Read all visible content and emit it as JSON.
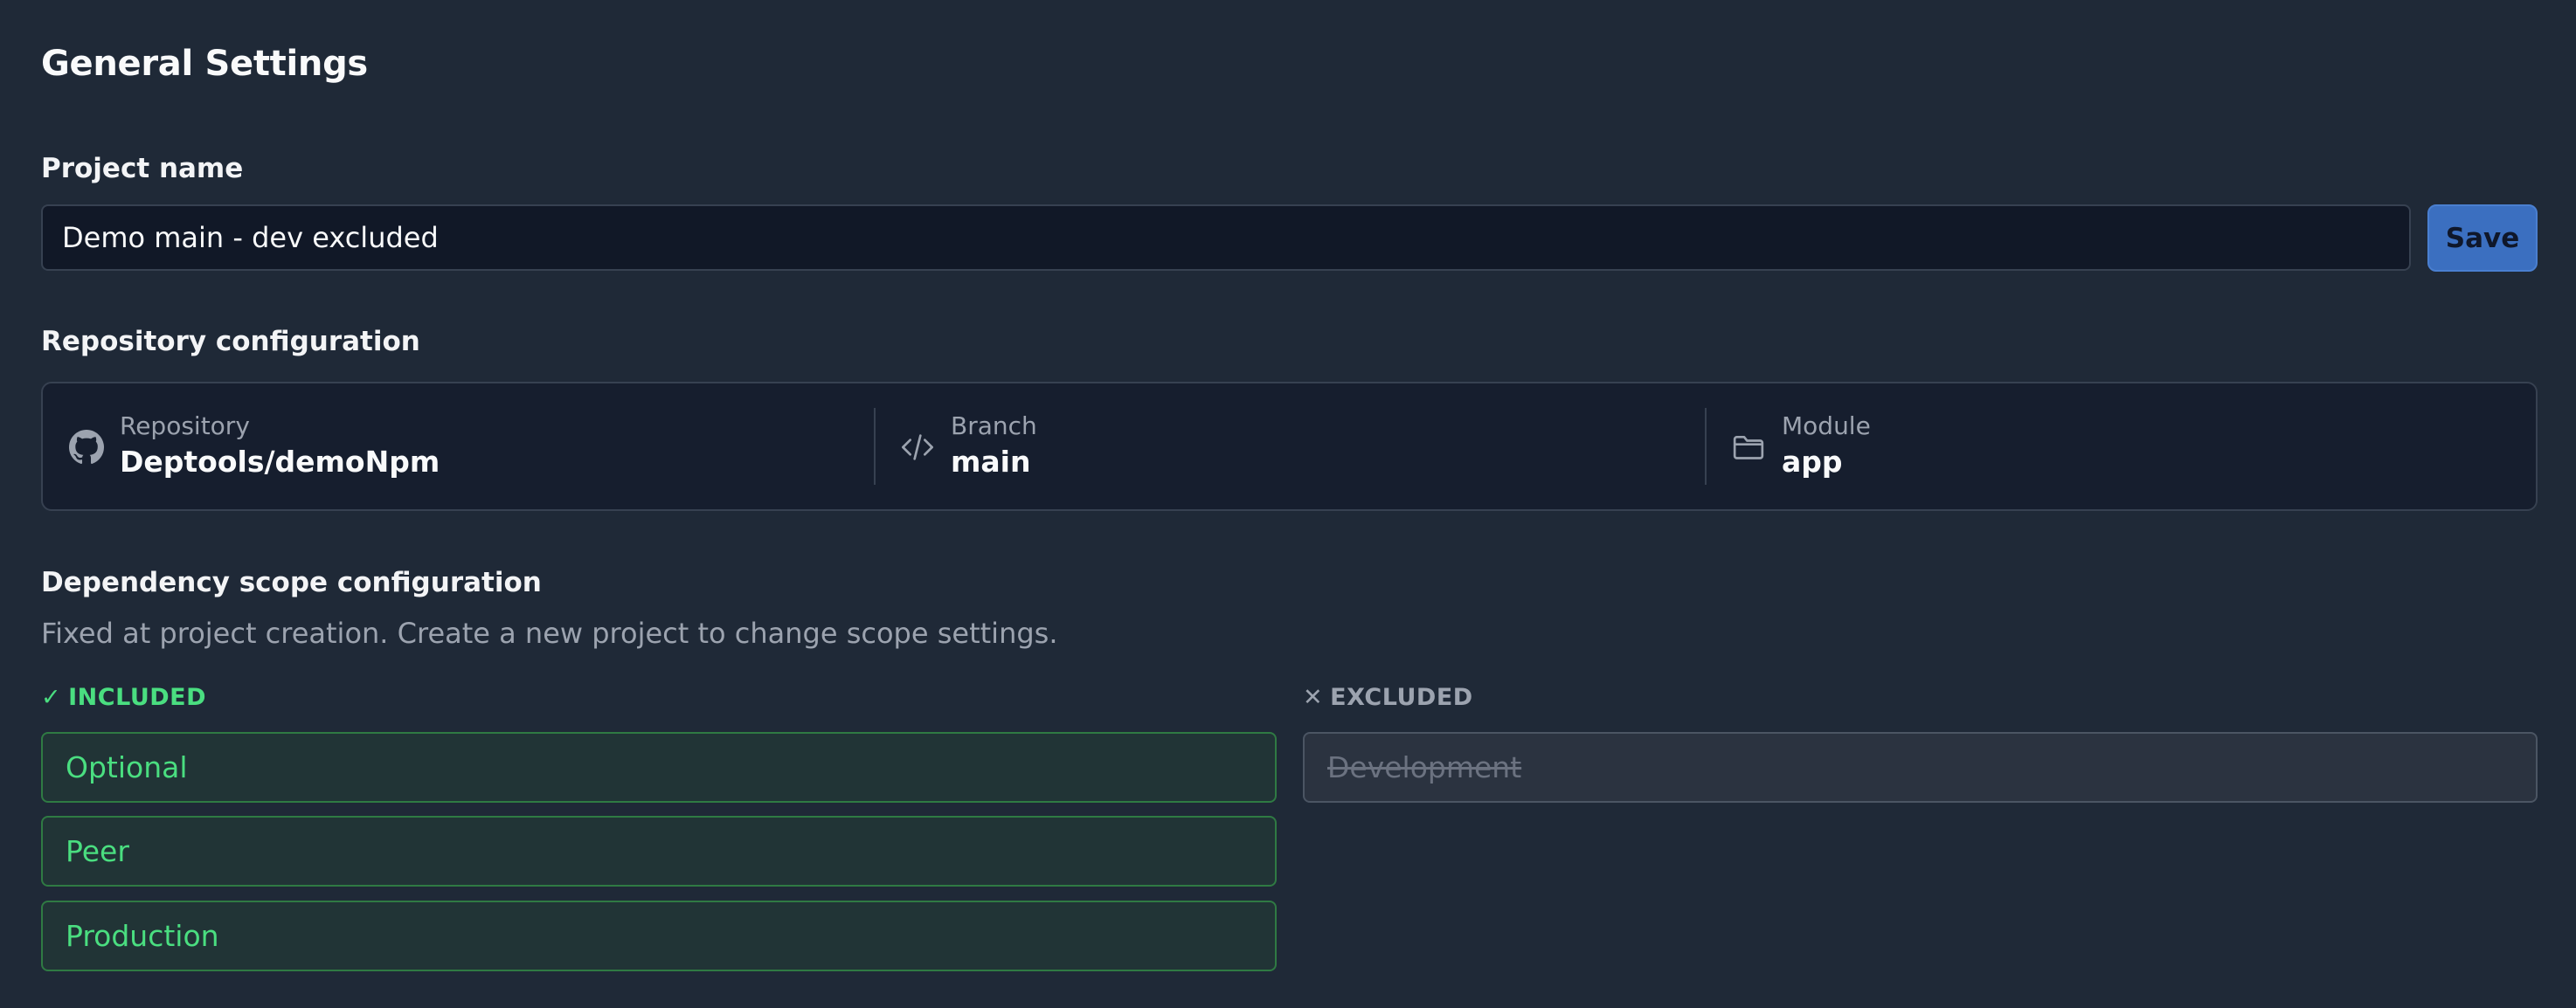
{
  "page": {
    "title": "General Settings"
  },
  "project": {
    "label": "Project name",
    "value": "Demo main - dev excluded",
    "save_label": "Save"
  },
  "repository": {
    "label": "Repository configuration",
    "items": [
      {
        "key": "Repository",
        "value": "Deptools/demoNpm",
        "icon": "github-icon"
      },
      {
        "key": "Branch",
        "value": "main",
        "icon": "code-icon"
      },
      {
        "key": "Module",
        "value": "app",
        "icon": "folder-icon"
      }
    ]
  },
  "scope": {
    "label": "Dependency scope configuration",
    "description": "Fixed at project creation. Create a new project to change scope settings.",
    "included": {
      "mark": "✓",
      "heading": "INCLUDED",
      "items": [
        "Optional",
        "Peer",
        "Production"
      ]
    },
    "excluded": {
      "mark": "✕",
      "heading": "EXCLUDED",
      "items": [
        "Development"
      ]
    }
  },
  "colors": {
    "background": "#1f2937",
    "accent": "#3b6fc0",
    "included": "#4ade80",
    "excluded": "#6b7280"
  }
}
